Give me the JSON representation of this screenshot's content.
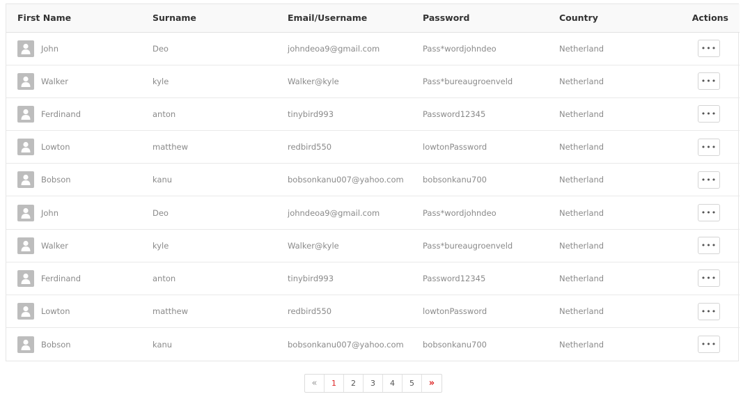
{
  "table": {
    "headers": [
      "First Name",
      "Surname",
      "Email/Username",
      "Password",
      "Country",
      "Actions"
    ],
    "rows": [
      {
        "first": "John",
        "surname": "Deo",
        "email": "johndeoa9@gmail.com",
        "password": "Pass*wordjohndeo",
        "country": "Netherland",
        "action": "•••"
      },
      {
        "first": "Walker",
        "surname": "kyle",
        "email": "Walker@kyle",
        "password": "Pass*bureaugroenveld",
        "country": "Netherland",
        "action": "•••"
      },
      {
        "first": "Ferdinand",
        "surname": "anton",
        "email": "tinybird993",
        "password": "Password12345",
        "country": "Netherland",
        "action": "•••"
      },
      {
        "first": "Lowton",
        "surname": "matthew",
        "email": "redbird550",
        "password": "lowtonPassword",
        "country": "Netherland",
        "action": "•••"
      },
      {
        "first": "Bobson",
        "surname": "kanu",
        "email": "bobsonkanu007@yahoo.com",
        "password": "bobsonkanu700",
        "country": "Netherland",
        "action": "•••"
      },
      {
        "first": "John",
        "surname": "Deo",
        "email": "johndeoa9@gmail.com",
        "password": "Pass*wordjohndeo",
        "country": "Netherland",
        "action": "•••"
      },
      {
        "first": "Walker",
        "surname": "kyle",
        "email": "Walker@kyle",
        "password": "Pass*bureaugroenveld",
        "country": "Netherland",
        "action": "•••"
      },
      {
        "first": "Ferdinand",
        "surname": "anton",
        "email": "tinybird993",
        "password": "Password12345",
        "country": "Netherland",
        "action": "•••"
      },
      {
        "first": "Lowton",
        "surname": "matthew",
        "email": "redbird550",
        "password": "lowtonPassword",
        "country": "Netherland",
        "action": "•••"
      },
      {
        "first": "Bobson",
        "surname": "kanu",
        "email": "bobsonkanu007@yahoo.com",
        "password": "bobsonkanu700",
        "country": "Netherland",
        "action": "•••"
      }
    ]
  },
  "pagination": {
    "prev": "«",
    "pages": [
      "1",
      "2",
      "3",
      "4",
      "5"
    ],
    "next": "»",
    "active_page": "1"
  },
  "icons": {
    "avatar": "user-avatar-icon",
    "actions": "more-horizontal-icon"
  },
  "colors": {
    "header_bg": "#f9f9f9",
    "avatar_bg": "#bdbdbd",
    "pagination_accent": "#dd2222"
  }
}
